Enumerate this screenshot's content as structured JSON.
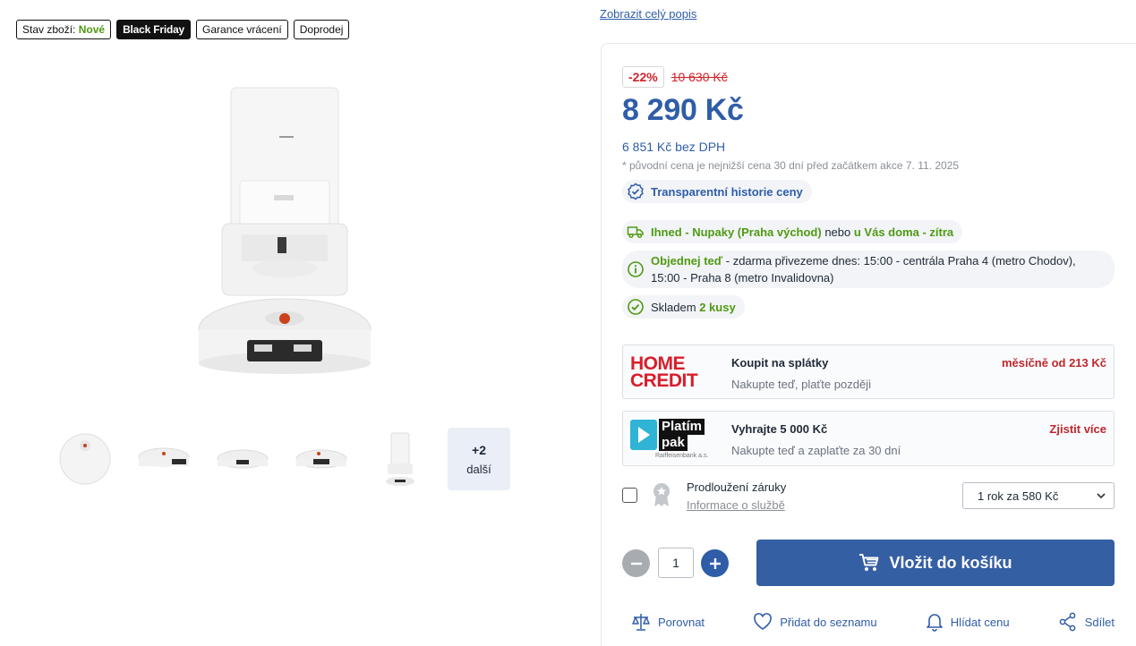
{
  "badges": {
    "condition_label": "Stav zboží:",
    "condition_value": "Nové",
    "black_friday": "Black Friday",
    "return_guarantee": "Garance vrácení",
    "clearance": "Doprodej"
  },
  "gallery": {
    "more_count": "+2",
    "more_label": "další"
  },
  "description_link": "Zobrazit celý popis",
  "pricing": {
    "discount": "-22%",
    "old_price": "10 630 Kč",
    "price": "8 290 Kč",
    "price_without_vat": "6 851 Kč bez DPH",
    "note": "* původní cena je nejnižší cena 30 dní před začátkem akce 7. 11. 2025",
    "history_label": "Transparentní historie ceny"
  },
  "delivery": {
    "now": "Ihned - Nupaky (Praha východ)",
    "or": "nebo",
    "home": "u Vás doma - zítra",
    "order_bold": "Objednej teď",
    "order_text": "- zdarma přivezeme dnes: 15:00 - centrála Praha 4 (metro Chodov), 15:00 - Praha 8 (metro Invalidovna)",
    "stock_label": "Skladem",
    "stock_value": "2 kusy"
  },
  "home_credit": {
    "logo_line1": "HOME",
    "logo_line2": "CREDIT",
    "title": "Koupit na splátky",
    "subtitle": "Nakupte teď, plaťte později",
    "right": "měsíčně od 213 Kč"
  },
  "platim_pak": {
    "logo_line1": "Platím",
    "logo_line2": "pak",
    "logo_sub": "Raiffeisenbank a.s.",
    "title": "Vyhrajte 5 000 Kč",
    "subtitle": "Nakupte teď a zaplaťte za 30 dní",
    "right": "Zjistit více"
  },
  "warranty": {
    "title": "Prodloužení záruky",
    "link": "Informace o službě",
    "selected": "1 rok za 580 Kč"
  },
  "cart": {
    "quantity": "1",
    "button": "Vložit do košíku"
  },
  "actions": {
    "compare": "Porovnat",
    "wishlist": "Přidat do seznamu",
    "watch_price": "Hlídat cenu",
    "share": "Sdílet"
  },
  "colors": {
    "brand_blue": "#2f5da8",
    "green": "#4f9a12",
    "red": "#d2232a"
  }
}
